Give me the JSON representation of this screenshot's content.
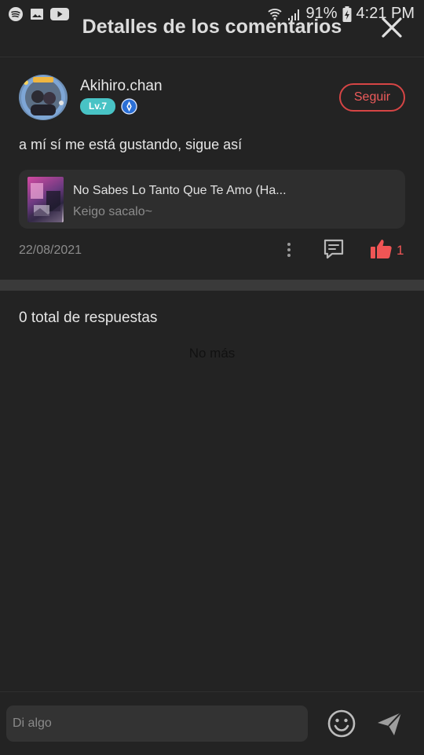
{
  "status": {
    "battery_pct": "91%",
    "time": "4:21 PM",
    "left_icons": [
      "spotify-icon",
      "image-icon",
      "youtube-icon"
    ]
  },
  "header": {
    "title": "Detalles de los comentarios"
  },
  "user": {
    "name": "Akihiro.chan",
    "level": "Lv.7",
    "follow_label": "Seguir"
  },
  "comment": {
    "text": "a mí sí me está gustando, sigue así",
    "date": "22/08/2021",
    "likes": "1"
  },
  "song": {
    "title": "No Sabes Lo Tanto Que Te Amo (Ha...",
    "subtitle": "Keigo sacalo~"
  },
  "replies": {
    "count_label": "0 total de respuestas",
    "no_more": "No más"
  },
  "composer": {
    "placeholder": "Di algo"
  },
  "colors": {
    "background": "#232323",
    "accent_red": "#ef5555",
    "level_badge": "#48c3c5"
  }
}
